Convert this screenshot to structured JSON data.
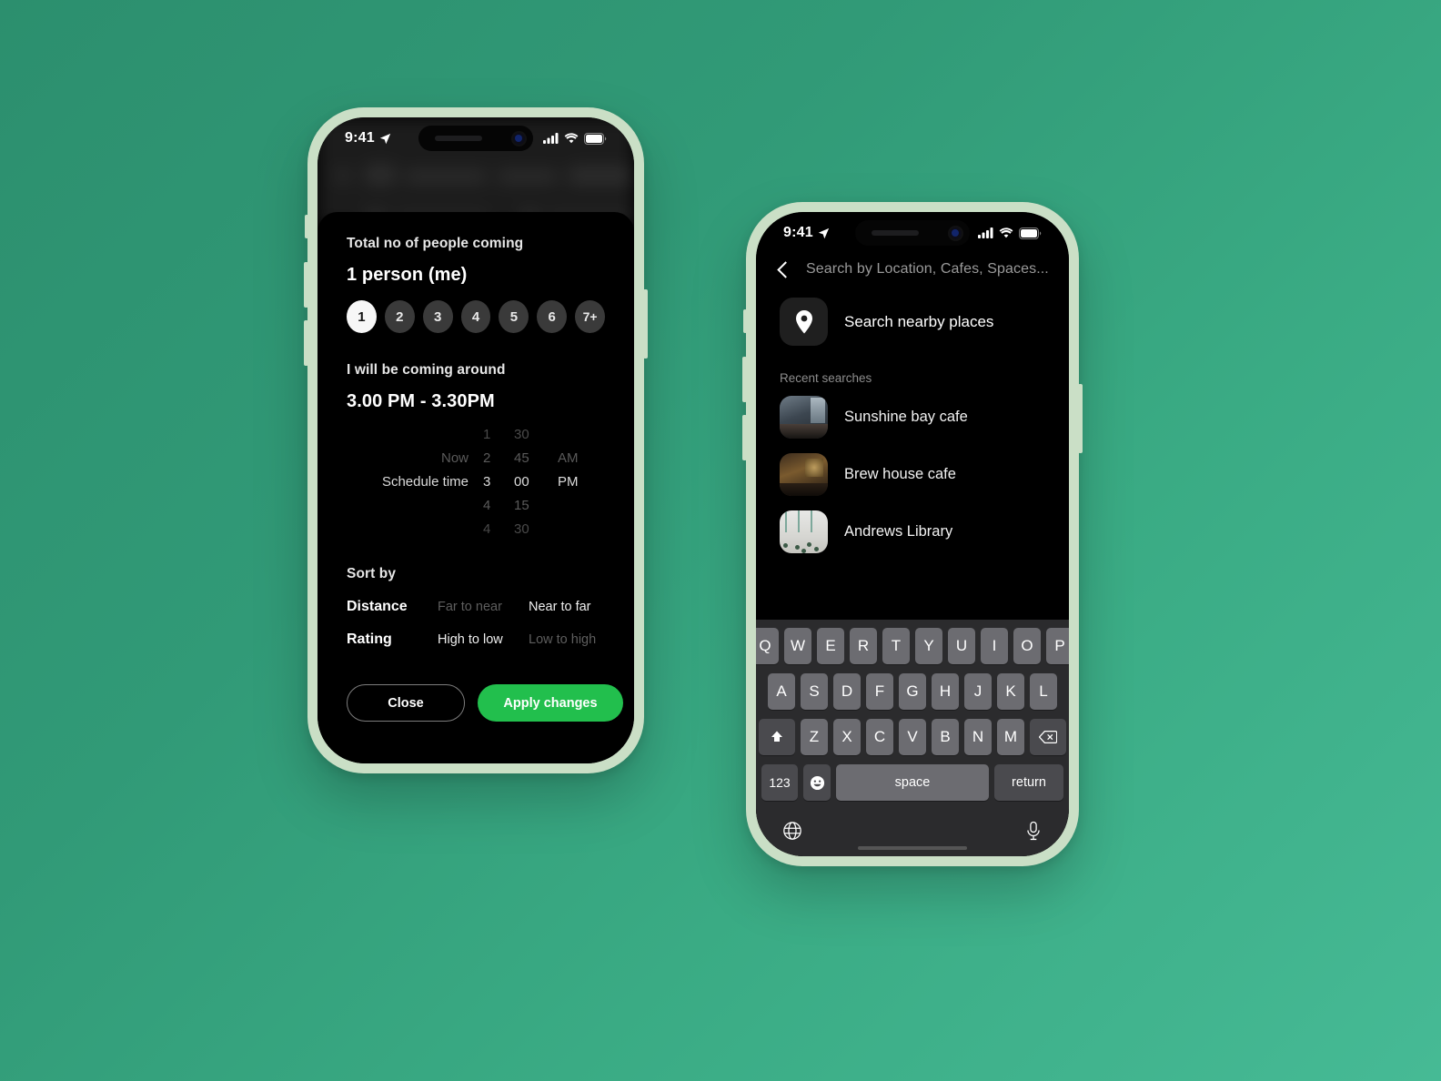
{
  "background": {
    "color_top": "#2c8f6e",
    "color_bottom": "#46ba95"
  },
  "accent": {
    "green": "#22bf4d",
    "frame": "#cadfc6"
  },
  "phone_left": {
    "status_bar": {
      "time": "9:41",
      "location_icon": "location-arrow-icon",
      "cellular": "cellular-icon",
      "wifi": "wifi-icon",
      "battery": "battery-icon"
    },
    "people": {
      "section_label": "Total no of people coming",
      "value": "1 person (me)",
      "options": [
        "1",
        "2",
        "3",
        "4",
        "5",
        "6",
        "7+"
      ],
      "selected": "1"
    },
    "time": {
      "section_label": "I will be coming around",
      "value": "3.00 PM - 3.30PM",
      "rows": [
        {
          "label": "",
          "hour": "1",
          "minute": "30",
          "ampm": "",
          "state": "dim2"
        },
        {
          "label": "Now",
          "hour": "2",
          "minute": "45",
          "ampm": "AM",
          "state": "dim"
        },
        {
          "label": "Schedule time",
          "hour": "3",
          "minute": "00",
          "ampm": "PM",
          "state": "active"
        },
        {
          "label": "",
          "hour": "4",
          "minute": "15",
          "ampm": "",
          "state": "dim"
        },
        {
          "label": "",
          "hour": "4",
          "minute": "30",
          "ampm": "",
          "state": "dim2"
        }
      ]
    },
    "sort": {
      "section_label": "Sort by",
      "rows": [
        {
          "name": "Distance",
          "option_1": "Far to near",
          "option_2": "Near to far",
          "selected": "Near to far"
        },
        {
          "name": "Rating",
          "option_1": "High to low",
          "option_2": "Low to high",
          "selected": "High to low"
        }
      ]
    },
    "actions": {
      "close_label": "Close",
      "apply_label": "Apply changes"
    }
  },
  "phone_right": {
    "status_bar": {
      "time": "9:41",
      "location_icon": "location-arrow-icon",
      "cellular": "cellular-icon",
      "wifi": "wifi-icon",
      "battery": "battery-icon"
    },
    "search": {
      "back_icon": "chevron-left-icon",
      "placeholder": "Search by Location, Cafes, Spaces...",
      "value": ""
    },
    "nearby": {
      "icon": "map-pin-icon",
      "label": "Search nearby places"
    },
    "recent": {
      "header": "Recent searches",
      "items": [
        {
          "label": "Sunshine bay cafe",
          "thumb": "cafe-interior-photo"
        },
        {
          "label": "Brew house cafe",
          "thumb": "brewhouse-interior-photo"
        },
        {
          "label": "Andrews Library",
          "thumb": "library-interior-photo"
        }
      ]
    },
    "keyboard": {
      "row1": [
        "Q",
        "W",
        "E",
        "R",
        "T",
        "Y",
        "U",
        "I",
        "O",
        "P"
      ],
      "row2": [
        "A",
        "S",
        "D",
        "F",
        "G",
        "H",
        "J",
        "K",
        "L"
      ],
      "row3": [
        "Z",
        "X",
        "C",
        "V",
        "B",
        "N",
        "M"
      ],
      "shift_icon": "shift-arrow-icon",
      "delete_icon": "backspace-icon",
      "numbers_label": "123",
      "emoji_icon": "emoji-smiley-icon",
      "space_label": "space",
      "return_label": "return",
      "globe_icon": "globe-icon",
      "mic_icon": "microphone-icon"
    }
  }
}
